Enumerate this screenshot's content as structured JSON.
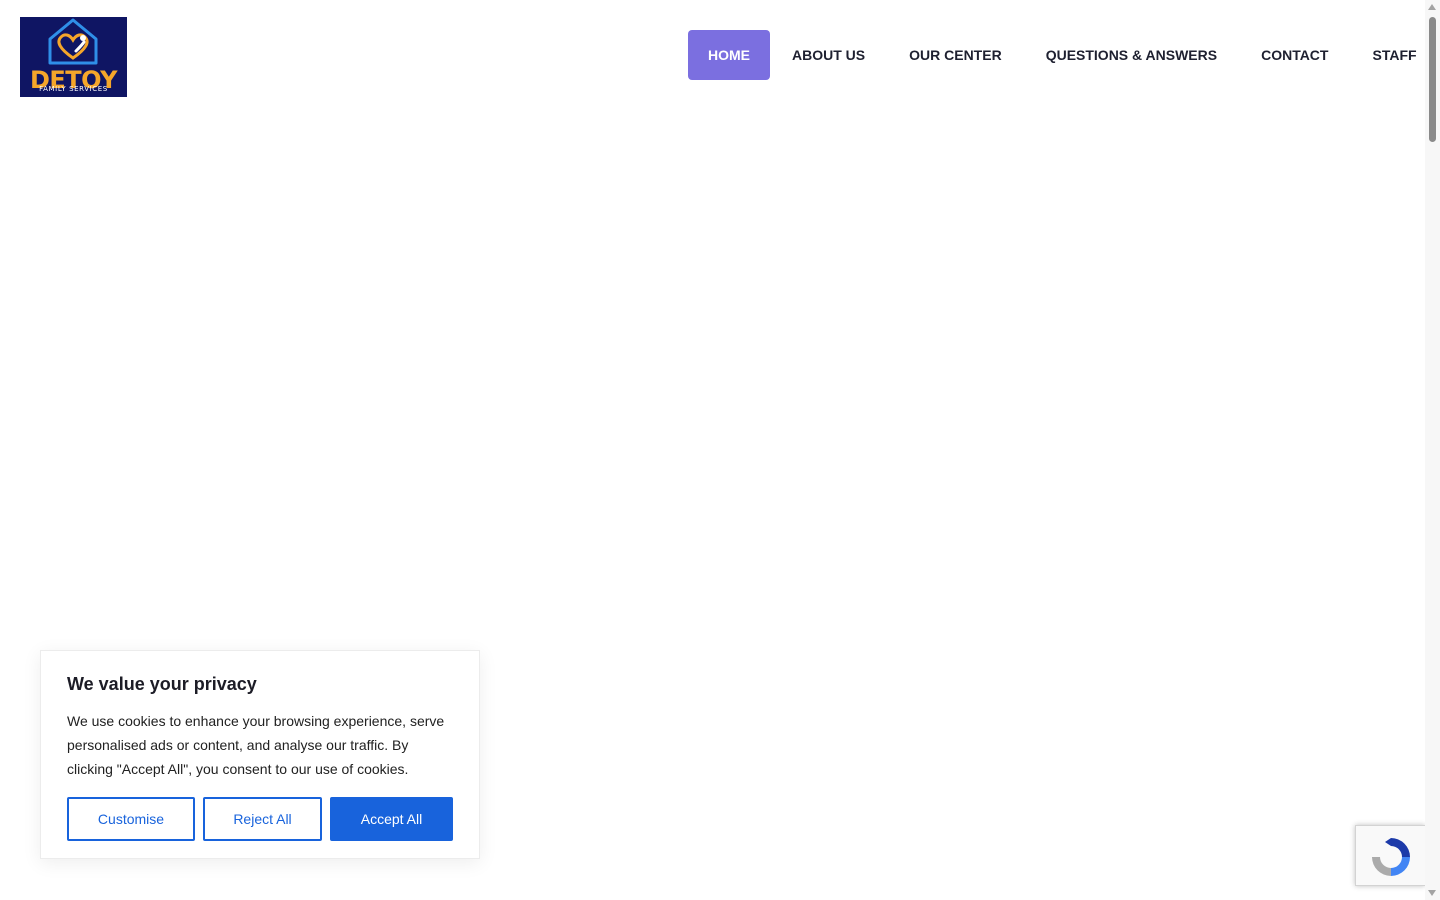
{
  "logo": {
    "word": "DETOY",
    "subtitle": "FAMILY SERVICES"
  },
  "nav": {
    "items": [
      {
        "label": "HOME",
        "active": true
      },
      {
        "label": "ABOUT US",
        "active": false
      },
      {
        "label": "OUR CENTER",
        "active": false
      },
      {
        "label": "QUESTIONS & ANSWERS",
        "active": false
      },
      {
        "label": "CONTACT",
        "active": false
      },
      {
        "label": "STAFF",
        "active": false
      }
    ]
  },
  "cookie_banner": {
    "title": "We value your privacy",
    "text": "We use cookies to enhance your browsing experience, serve personalised ads or content, and analyse our traffic. By clicking \"Accept All\", you consent to our use of cookies.",
    "customise_label": "Customise",
    "reject_label": "Reject All",
    "accept_label": "Accept All"
  },
  "colors": {
    "nav_active_bg": "#7b6fe0",
    "cookie_accent": "#1863dc",
    "logo_bg": "#0f1563",
    "logo_text": "#f5a62a"
  },
  "icons": {
    "recaptcha": "recaptcha-icon",
    "logo_emblem": "heart-house-icon"
  }
}
